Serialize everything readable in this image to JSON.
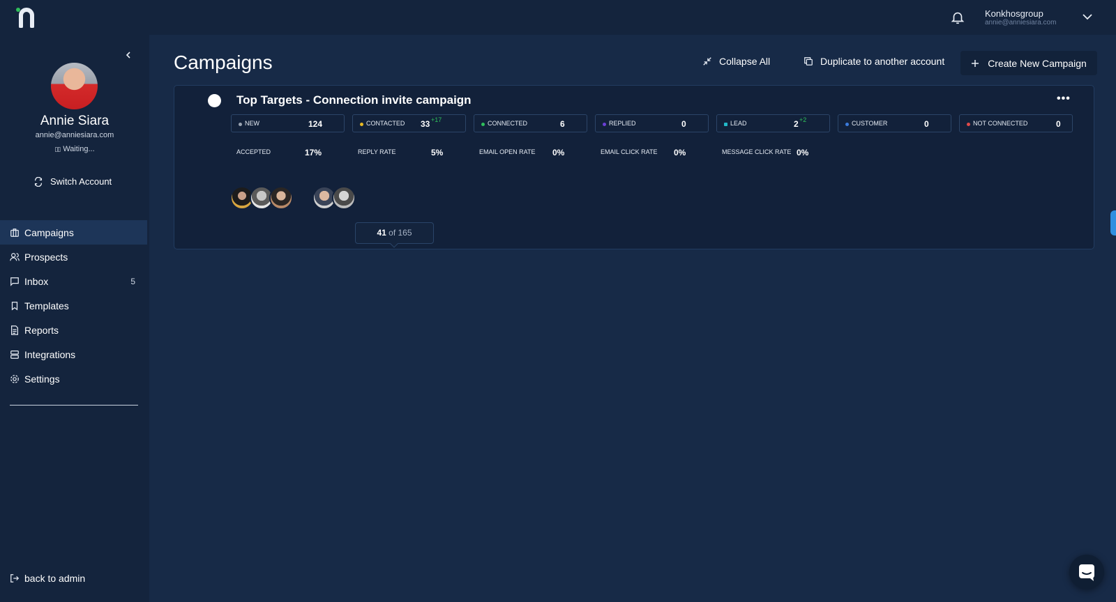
{
  "topbar": {
    "account_name": "Konkhosgroup",
    "account_email": "annie@anniesiara.com"
  },
  "sidebar": {
    "user_name": "Annie Siara",
    "user_email": "annie@anniesiara.com",
    "user_status": "Waiting...",
    "switch_account": "Switch Account",
    "items": [
      {
        "label": "Campaigns",
        "icon": "campaigns-icon",
        "active": true
      },
      {
        "label": "Prospects",
        "icon": "prospects-icon"
      },
      {
        "label": "Inbox",
        "icon": "inbox-icon",
        "badge": "5"
      },
      {
        "label": "Templates",
        "icon": "bookmark-icon"
      },
      {
        "label": "Reports",
        "icon": "report-icon"
      },
      {
        "label": "Integrations",
        "icon": "integrations-icon"
      },
      {
        "label": "Settings",
        "icon": "gear-icon"
      }
    ],
    "back_to_admin": "back to admin"
  },
  "main": {
    "title": "Campaigns",
    "collapse_all": "Collapse All",
    "duplicate": "Duplicate to another account",
    "create": "Create New Campaign"
  },
  "campaign": {
    "title": "Top Targets - Connection invite campaign",
    "stats": [
      {
        "label": "NEW",
        "value": "124",
        "delta": "",
        "color": "#9aa4b2"
      },
      {
        "label": "CONTACTED",
        "value": "33",
        "delta": "+17",
        "color": "#e8b923"
      },
      {
        "label": "CONNECTED",
        "value": "6",
        "delta": "",
        "color": "#2fbf5b"
      },
      {
        "label": "REPLIED",
        "value": "0",
        "delta": "",
        "color": "#6b3fd6"
      },
      {
        "label": "LEAD",
        "value": "2",
        "delta": "+2",
        "color": "#22b8c8"
      },
      {
        "label": "CUSTOMER",
        "value": "0",
        "delta": "",
        "color": "#3b7bdb"
      },
      {
        "label": "NOT CONNECTED",
        "value": "0",
        "delta": "",
        "color": "#e04a4a"
      }
    ],
    "rates": [
      {
        "label": "ACCEPTED",
        "value": "17%"
      },
      {
        "label": "REPLY RATE",
        "value": "5%"
      },
      {
        "label": "EMAIL OPEN RATE",
        "value": "0%"
      },
      {
        "label": "EMAIL CLICK RATE",
        "value": "0%"
      },
      {
        "label": "MESSAGE CLICK RATE",
        "value": "0%"
      }
    ],
    "progress_current": "41",
    "progress_total": "of 165"
  },
  "colors": {
    "background": "#172a47",
    "sidebar": "#14243d",
    "card": "#12213a",
    "accent_green": "#2fbf5b",
    "side_tab": "#2f8fe0"
  }
}
